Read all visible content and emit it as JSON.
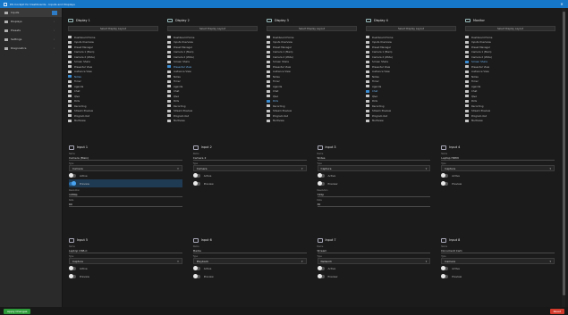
{
  "window": {
    "title": "DS Cockpit for Dashboards - Inputs and Displays"
  },
  "sidebar": {
    "items": [
      {
        "label": "Inputs",
        "active": true
      },
      {
        "label": "Displays",
        "active": false
      },
      {
        "label": "Presets",
        "active": false
      },
      {
        "label": "Settings",
        "active": false
      },
      {
        "label": "Diagnostics",
        "active": false
      }
    ]
  },
  "displays": [
    {
      "title": "Display 1",
      "select": "Select Display Layout",
      "items": [
        "Dashboard Home",
        "Inputs Overview",
        "Preset Manager",
        "Camera 1 (Main)",
        "Camera 2 (Wide)",
        "Screen Share",
        "Presenter View",
        "Audience View",
        "Notes",
        "Timer",
        "Agenda",
        "Chat",
        "Q&A",
        "Polls",
        "Recording",
        "Stream Preview",
        "Program Out",
        "Multiview"
      ],
      "selected": 8
    },
    {
      "title": "Display 2",
      "select": "Select Display Layout",
      "items": [
        "Dashboard Home",
        "Inputs Overview",
        "Preset Manager",
        "Camera 1 (Main)",
        "Camera 2 (Wide)",
        "Screen Share",
        "Presenter View",
        "Audience View",
        "Notes",
        "Timer",
        "Agenda",
        "Chat",
        "Q&A",
        "Polls",
        "Recording",
        "Stream Preview",
        "Program Out",
        "Multiview"
      ],
      "selected": 6
    },
    {
      "title": "Display 3",
      "select": "Select Display Layout",
      "items": [
        "Dashboard Home",
        "Inputs Overview",
        "Preset Manager",
        "Camera 1 (Main)",
        "Camera 2 (Wide)",
        "Screen Share",
        "Presenter View",
        "Audience View",
        "Notes",
        "Timer",
        "Agenda",
        "Chat",
        "Q&A",
        "Polls",
        "Recording",
        "Stream Preview",
        "Program Out",
        "Multiview"
      ],
      "selected": 13
    },
    {
      "title": "Display 4",
      "select": "Select Display Layout",
      "items": [
        "Dashboard Home",
        "Inputs Overview",
        "Preset Manager",
        "Camera 1 (Main)",
        "Camera 2 (Wide)",
        "Screen Share",
        "Presenter View",
        "Audience View",
        "Notes",
        "Timer",
        "Agenda",
        "Chat",
        "Q&A",
        "Polls",
        "Recording",
        "Stream Preview",
        "Program Out",
        "Multiview"
      ],
      "selected": 11
    },
    {
      "title": "Monitor",
      "select": "Select Display Layout",
      "items": [
        "Dashboard Home",
        "Inputs Overview",
        "Preset Manager",
        "Camera 1 (Main)",
        "Camera 2 (Wide)",
        "Screen Share",
        "Presenter View",
        "Audience View",
        "Notes",
        "Timer",
        "Agenda",
        "Chat",
        "Q&A",
        "Polls",
        "Recording",
        "Stream Preview",
        "Program Out",
        "Multiview"
      ],
      "selected": 5
    }
  ],
  "inputs_row1": [
    {
      "title": "Input 1",
      "name_label": "Name",
      "name": "Camera (Main)",
      "type_label": "Type",
      "type": "Camera",
      "toggle1": "Active",
      "toggle1_on": false,
      "toggle2": "Preview",
      "toggle2_on": true,
      "extra_label": "Resolution",
      "extra": "1080p",
      "extra2_label": "Rate",
      "extra2": "60"
    },
    {
      "title": "Input 2",
      "name_label": "Name",
      "name": "Camera 2",
      "type_label": "Type",
      "type": "Camera",
      "toggle1": "Active",
      "toggle1_on": false,
      "toggle2": "Preview",
      "toggle2_on": false,
      "extra_label": "",
      "extra": "",
      "extra2_label": "",
      "extra2": ""
    },
    {
      "title": "Input 3",
      "name_label": "Name",
      "name": "Slides",
      "type_label": "Type",
      "type": "Capture",
      "toggle1": "Active",
      "toggle1_on": false,
      "toggle2": "Preview",
      "toggle2_on": false,
      "extra_label": "Resolution",
      "extra": "720p",
      "extra2_label": "Rate",
      "extra2": "30"
    },
    {
      "title": "Input 4",
      "name_label": "Name",
      "name": "Laptop HDMI",
      "type_label": "Type",
      "type": "Capture",
      "toggle1": "Active",
      "toggle1_on": false,
      "toggle2": "Preview",
      "toggle2_on": false,
      "extra_label": "",
      "extra": "",
      "extra2_label": "",
      "extra2": ""
    }
  ],
  "inputs_row2": [
    {
      "title": "Input 5",
      "name_label": "Name",
      "name": "Laptop USB-C",
      "type_label": "Type",
      "type": "Capture",
      "toggle1": "Active",
      "toggle1_on": false,
      "toggle2": "Preview",
      "toggle2_on": false
    },
    {
      "title": "Input 6",
      "name_label": "Name",
      "name": "Media",
      "type_label": "Type",
      "type": "Playback",
      "toggle1": "Active",
      "toggle1_on": false,
      "toggle2": "Preview",
      "toggle2_on": false
    },
    {
      "title": "Input 7",
      "name_label": "Name",
      "name": "Stream",
      "type_label": "Type",
      "type": "Network",
      "toggle1": "Active",
      "toggle1_on": false,
      "toggle2": "Preview",
      "toggle2_on": false
    },
    {
      "title": "Input 8",
      "name_label": "Name",
      "name": "Document Cam",
      "type_label": "Type",
      "type": "Camera",
      "toggle1": "Active",
      "toggle1_on": false,
      "toggle2": "Preview",
      "toggle2_on": false
    }
  ],
  "status": {
    "left": "Apply Changes",
    "right": "Reset"
  },
  "colors": {
    "titlebar": "#1677c9",
    "accent": "#3d8fd6",
    "apply": "#2e9b3a",
    "reset": "#d33a2b"
  }
}
